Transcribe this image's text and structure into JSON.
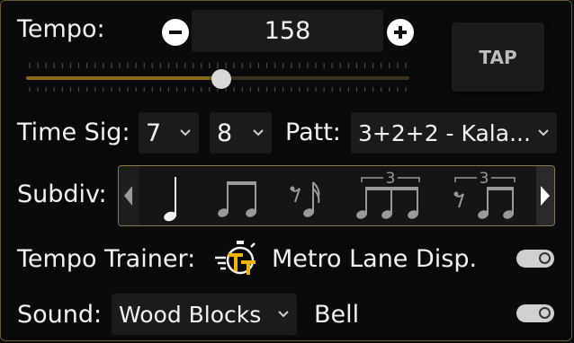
{
  "tempo": {
    "label": "Tempo:",
    "value": "158",
    "slider_fraction": 0.51,
    "tap_label": "TAP"
  },
  "time_sig": {
    "label": "Time Sig:",
    "numerator": "7",
    "denominator": "8"
  },
  "pattern": {
    "label": "Patt:",
    "value": "3+2+2 - Kala..."
  },
  "subdiv": {
    "label": "Subdiv:",
    "items": [
      {
        "name": "quarter-note-icon",
        "selected": true
      },
      {
        "name": "eighth-notes-icon",
        "selected": false
      },
      {
        "name": "eighth-rest-sixteenth-icon",
        "selected": false
      },
      {
        "name": "triplet-eighths-icon",
        "tuplet": "3",
        "selected": false
      },
      {
        "name": "triplet-rest-eighths-icon",
        "tuplet": "3",
        "selected": false
      }
    ]
  },
  "tempo_trainer": {
    "label": "Tempo Trainer:",
    "icon": "tempo-trainer-icon"
  },
  "metro_lane": {
    "label": "Metro Lane Disp.",
    "enabled": true
  },
  "sound": {
    "label": "Sound:",
    "value": "Wood Blocks",
    "bell_label": "Bell",
    "bell_enabled": true
  },
  "colors": {
    "accent": "#f2b400",
    "border": "#6a5a32",
    "background": "#0a0a0a"
  }
}
